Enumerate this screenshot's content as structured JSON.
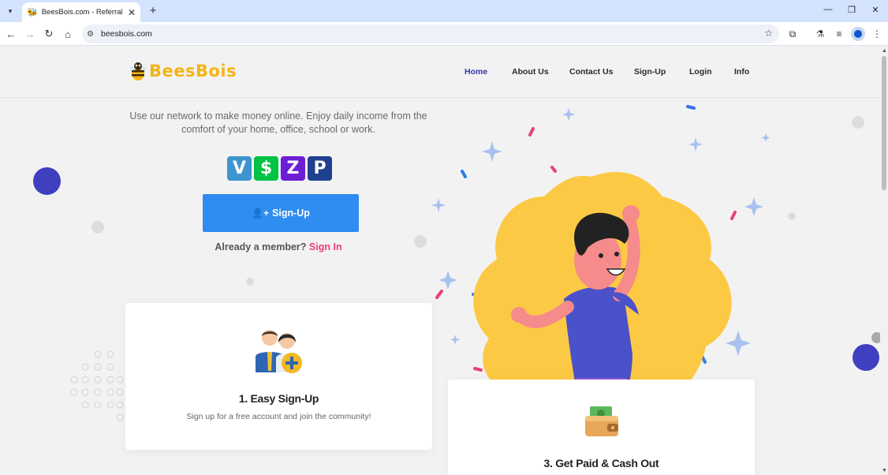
{
  "browser": {
    "tab_title": "BeesBois.com - Referral Networ",
    "url": "beesbois.com"
  },
  "site": {
    "logo_text": "BeesBois",
    "nav": [
      {
        "label": "Home",
        "active": true
      },
      {
        "label": "About Us",
        "active": false
      },
      {
        "label": "Contact Us",
        "active": false
      },
      {
        "label": "Sign-Up",
        "active": false
      },
      {
        "label": "Login",
        "active": false
      },
      {
        "label": "Info",
        "active": false
      }
    ]
  },
  "hero": {
    "tagline": "Use our network to make money online. Enjoy daily income from the comfort of your home, office, school or work.",
    "payment_methods": [
      "Venmo",
      "Cash App",
      "Zelle",
      "PayPal"
    ],
    "signup_button": "Sign-Up",
    "member_prompt": "Already a member?",
    "sign_in_link": "Sign In"
  },
  "cards": [
    {
      "title": "1. Easy Sign-Up",
      "description": "Sign up for a free account and join the community!"
    },
    {
      "title": "3. Get Paid & Cash Out",
      "description": ""
    }
  ],
  "colors": {
    "accent_blue": "#2f8cf0",
    "accent_pink": "#e8407a",
    "brand_yellow": "#f5b414",
    "nav_active": "#3535a8"
  }
}
